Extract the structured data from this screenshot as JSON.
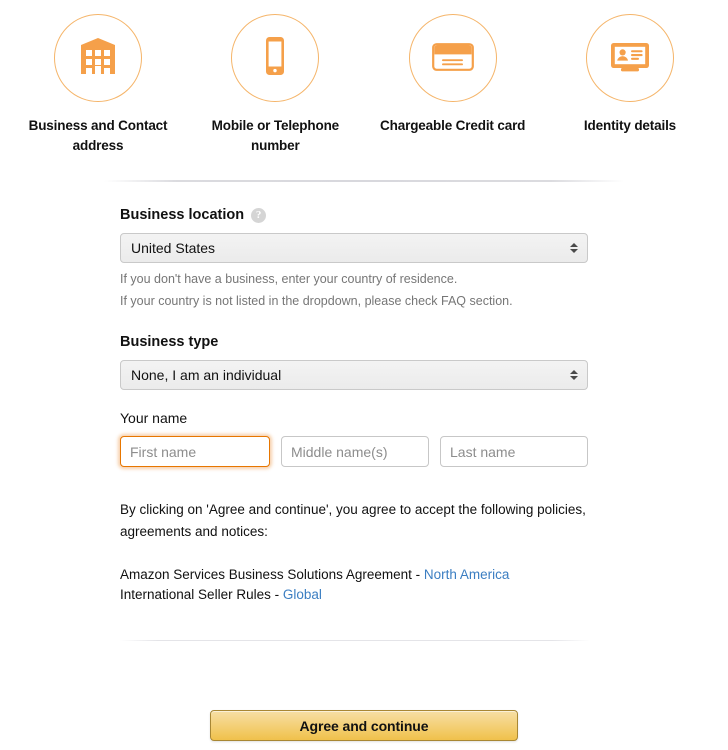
{
  "steps": [
    {
      "icon": "building-icon",
      "label": "Business and Contact address"
    },
    {
      "icon": "mobile-phone-icon",
      "label": "Mobile or Telephone number"
    },
    {
      "icon": "credit-card-icon",
      "label": "Chargeable Credit card"
    },
    {
      "icon": "id-card-icon",
      "label": "Identity details"
    }
  ],
  "form": {
    "business_location": {
      "label": "Business location",
      "help_icon": "question-mark-icon",
      "value": "United States",
      "hint_1": "If you don't have a business, enter your country of residence.",
      "hint_2": "If your country is not listed in the dropdown, please check FAQ section."
    },
    "business_type": {
      "label": "Business type",
      "value": "None, I am an individual"
    },
    "your_name": {
      "label": "Your name",
      "first_placeholder": "First name",
      "first_value": "",
      "middle_placeholder": "Middle name(s)",
      "middle_value": "",
      "last_placeholder": "Last name",
      "last_value": ""
    }
  },
  "legal": {
    "intro": "By clicking on 'Agree and continue', you agree to accept the following policies, agreements and notices:",
    "policies": [
      {
        "text": "Amazon Services Business Solutions Agreement - ",
        "link": "North America"
      },
      {
        "text": "International Seller Rules - ",
        "link": "Global"
      }
    ]
  },
  "submit": {
    "label": "Agree and continue"
  },
  "colors": {
    "accent_orange": "#f5a04a",
    "circle_border": "#f5b56a",
    "focus_orange": "#e77600",
    "link_blue": "#3b7ec2",
    "button_gold_top": "#f7dfa5",
    "button_gold_bottom": "#f0c14b",
    "button_border": "#a88734",
    "hint_gray": "#767676"
  }
}
